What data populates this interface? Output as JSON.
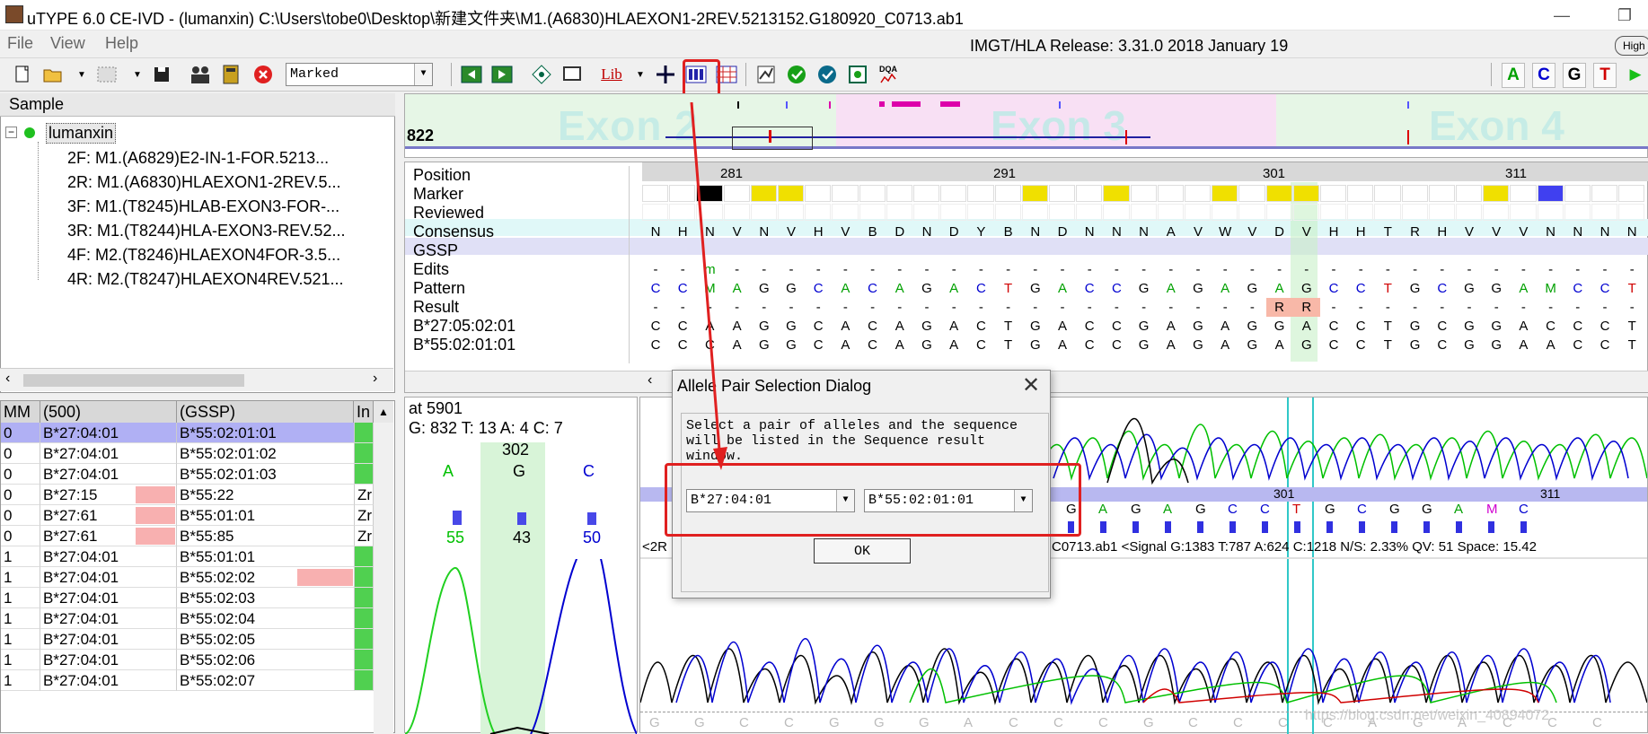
{
  "window": {
    "title": "uTYPE 6.0 CE-IVD - (lumanxin) C:\\Users\\tobe0\\Desktop\\新建文件夹\\M1.(A6830)HLAEXON1-2REV.5213152.G180920_C0713.ab1",
    "minimize": "—",
    "maximize": "❐"
  },
  "menu": {
    "file": "File",
    "view": "View",
    "help": "Help"
  },
  "release": "IMGT/HLA Release: 3.31.0 2018 January 19",
  "high_badge": "High",
  "toolbar": {
    "marked_combo": "Marked",
    "lib_label": "Lib",
    "dqa_label": "DQA"
  },
  "bases": [
    "A",
    "C",
    "G",
    "T"
  ],
  "base_colors": {
    "A": "#00a000",
    "C": "#0000d0",
    "G": "#000000",
    "T": "#d00000"
  },
  "sample": {
    "header": "Sample",
    "root": "lumanxin",
    "items": [
      "2F: M1.(A6829)E2-IN-1-FOR.5213...",
      "2R: M1.(A6830)HLAEXON1-2REV.5...",
      "3F: M1.(T8245)HLAB-EXON3-FOR-...",
      "3R: M1.(T8244)HLA-EXON3-REV.52...",
      "4F: M2.(T8246)HLAEXON4FOR-3.5...",
      "4R: M2.(T8247)HLAEXON4REV.521..."
    ]
  },
  "grid": {
    "headers": [
      "MM",
      "(500)",
      "(GSSP)",
      "In"
    ],
    "rows": [
      [
        "0",
        "B*27:04:01",
        "B*55:02:01:01"
      ],
      [
        "0",
        "B*27:04:01",
        "B*55:02:01:02"
      ],
      [
        "0",
        "B*27:04:01",
        "B*55:02:01:03"
      ],
      [
        "0",
        "B*27:15",
        "B*55:22",
        "Zr"
      ],
      [
        "0",
        "B*27:61",
        "B*55:01:01",
        "Zr"
      ],
      [
        "0",
        "B*27:61",
        "B*55:85",
        "Zr"
      ],
      [
        "1",
        "B*27:04:01",
        "B*55:01:01"
      ],
      [
        "1",
        "B*27:04:01",
        "B*55:02:02"
      ],
      [
        "1",
        "B*27:04:01",
        "B*55:02:03"
      ],
      [
        "1",
        "B*27:04:01",
        "B*55:02:04"
      ],
      [
        "1",
        "B*27:04:01",
        "B*55:02:05"
      ],
      [
        "1",
        "B*27:04:01",
        "B*55:02:06"
      ],
      [
        "1",
        "B*27:04:01",
        "B*55:02:07"
      ]
    ]
  },
  "exon": {
    "position": "822",
    "labels": [
      "Exon 2",
      "Exon 3",
      "Exon 4"
    ]
  },
  "sequence": {
    "row_labels": [
      "Position",
      "Marker",
      "Reviewed",
      "Consensus",
      "GSSP",
      "Edits",
      "Pattern",
      "Result",
      "B*27:05:02:01",
      "B*55:02:01:01"
    ],
    "ticks": [
      "281",
      "291",
      "301",
      "311"
    ],
    "consensus": [
      "N",
      "H",
      "N",
      "V",
      "N",
      "V",
      "H",
      "V",
      "B",
      "D",
      "N",
      "D",
      "Y",
      "B",
      "N",
      "D",
      "N",
      "N",
      "N",
      "A",
      "V",
      "W",
      "V",
      "D",
      "V",
      "H",
      "H",
      "T",
      "R",
      "H",
      "V",
      "V",
      "V",
      "N",
      "N",
      "N",
      "N"
    ],
    "edits": [
      "-",
      "-",
      "m",
      "-",
      "-",
      "-",
      "-",
      "-",
      "-",
      "-",
      "-",
      "-",
      "-",
      "-",
      "-",
      "-",
      "-",
      "-",
      "-",
      "-",
      "-",
      "-",
      "-",
      "-",
      "-",
      "-",
      "-",
      "-",
      "-",
      "-",
      "-",
      "-",
      "-",
      "-",
      "-",
      "-",
      "-"
    ],
    "pattern": [
      "C",
      "C",
      "M",
      "A",
      "G",
      "G",
      "C",
      "A",
      "C",
      "A",
      "G",
      "A",
      "C",
      "T",
      "G",
      "A",
      "C",
      "C",
      "G",
      "A",
      "G",
      "A",
      "G",
      "A",
      "G",
      "C",
      "C",
      "T",
      "G",
      "C",
      "G",
      "G",
      "A",
      "M",
      "C",
      "C",
      "T"
    ],
    "result": [
      "-",
      "-",
      "-",
      "-",
      "-",
      "-",
      "-",
      "-",
      "-",
      "-",
      "-",
      "-",
      "-",
      "-",
      "-",
      "-",
      "-",
      "-",
      "-",
      "-",
      "-",
      "-",
      "-",
      "R",
      "R",
      "-",
      "-",
      "-",
      "-",
      "-",
      "-",
      "-",
      "-",
      "-",
      "-",
      "-",
      "-"
    ],
    "allele1": [
      "C",
      "C",
      "A",
      "A",
      "G",
      "G",
      "C",
      "A",
      "C",
      "A",
      "G",
      "A",
      "C",
      "T",
      "G",
      "A",
      "C",
      "C",
      "G",
      "A",
      "G",
      "A",
      "G",
      "G",
      "A",
      "C",
      "C",
      "T",
      "G",
      "C",
      "G",
      "G",
      "A",
      "C",
      "C",
      "C",
      "T"
    ],
    "allele2": [
      "C",
      "C",
      "C",
      "A",
      "G",
      "G",
      "C",
      "A",
      "C",
      "A",
      "G",
      "A",
      "C",
      "T",
      "G",
      "A",
      "C",
      "C",
      "G",
      "A",
      "G",
      "A",
      "G",
      "A",
      "G",
      "C",
      "C",
      "T",
      "G",
      "C",
      "G",
      "G",
      "A",
      "A",
      "C",
      "C",
      "T"
    ]
  },
  "peak": {
    "position": "at 5901",
    "counts": "G: 832 T: 13 A: 4 C: 7",
    "pos_label": "302",
    "base": "G",
    "left_base": "A",
    "right_base": "C",
    "values": [
      "55",
      "43",
      "50"
    ]
  },
  "trace": {
    "info": "<2R",
    "file_info": "C0713.ab1  <Signal G:1383 T:787 A:624 C:1218 N/S:  2.33% QV: 51  Space: 15.42",
    "ticks": [
      "301",
      "311"
    ],
    "bases": [
      "G",
      "A",
      "G",
      "A",
      "G",
      "C",
      "C",
      "T",
      "G",
      "C",
      "G",
      "G",
      "A",
      "M",
      "C"
    ],
    "bottom_bases": [
      "G",
      "G",
      "C",
      "C",
      "G",
      "G",
      "G",
      "A",
      "C",
      "C",
      "C",
      "G",
      "C",
      "C",
      "C",
      "C",
      "A",
      "G",
      "A",
      "C",
      "C",
      "C"
    ],
    "watermark": "https://blog.csdn.net/weixin_40894072"
  },
  "dialog": {
    "title": "Allele Pair Selection Dialog",
    "close": "✕",
    "text": "Select a pair of alleles and the sequence will be listed in the Sequence result window.",
    "allele1": "B*27:04:01",
    "allele2": "B*55:02:01:01",
    "ok": "OK"
  }
}
